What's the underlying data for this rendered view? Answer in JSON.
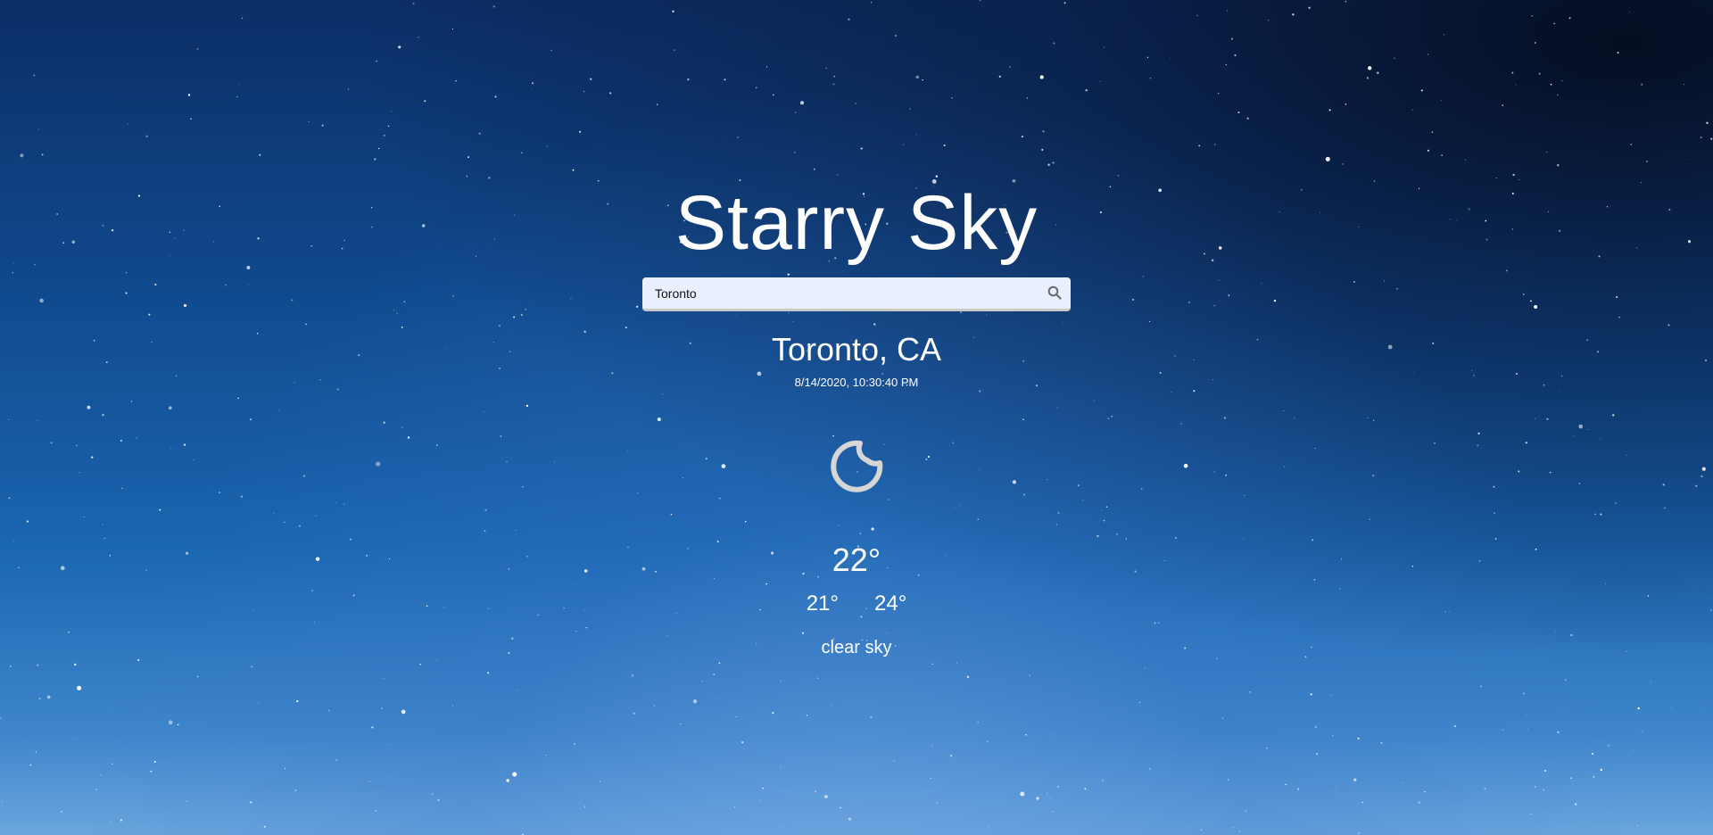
{
  "app": {
    "title": "Starry Sky"
  },
  "search": {
    "value": "Toronto",
    "icon": "search-icon"
  },
  "weather": {
    "location": "Toronto, CA",
    "datetime": "8/14/2020, 10:30:40 PM",
    "icon": "moon-clear-night-icon",
    "temperature": "22°",
    "temp_min": "21°",
    "temp_max": "24°",
    "description": "clear sky"
  },
  "colors": {
    "text": "#ffffff",
    "search_bg": "#e8f0fe",
    "icon_gray": "#d6d6d6",
    "sky_top": "#0c2e66",
    "sky_bottom": "#6aa5dd"
  }
}
